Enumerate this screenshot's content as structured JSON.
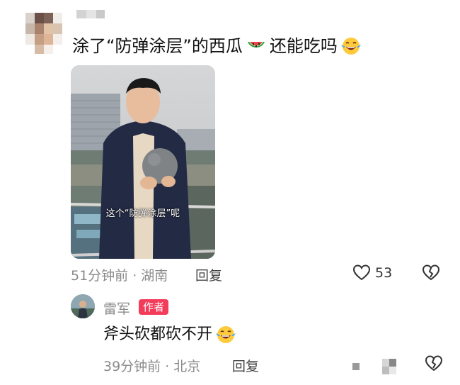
{
  "comment": {
    "text": "涂了“防弹涂层”的西瓜",
    "text_after_emoji": "还能吃吗",
    "video_caption": "这个“防弹涂层”呢",
    "time_location": "51分钟前 · 湖南",
    "reply_label": "回复",
    "like_count": "53"
  },
  "reply": {
    "author": "雷军",
    "badge": "作者",
    "text": "斧头砍都砍不开",
    "time_location": "39分钟前 · 北京",
    "reply_label": "回复"
  },
  "colors": {
    "badge": "#f33b5a",
    "meta": "#8a8a8a"
  },
  "icons": [
    "watermelon-icon",
    "laughing-tears-icon",
    "heart-outline-icon",
    "broken-heart-icon"
  ]
}
